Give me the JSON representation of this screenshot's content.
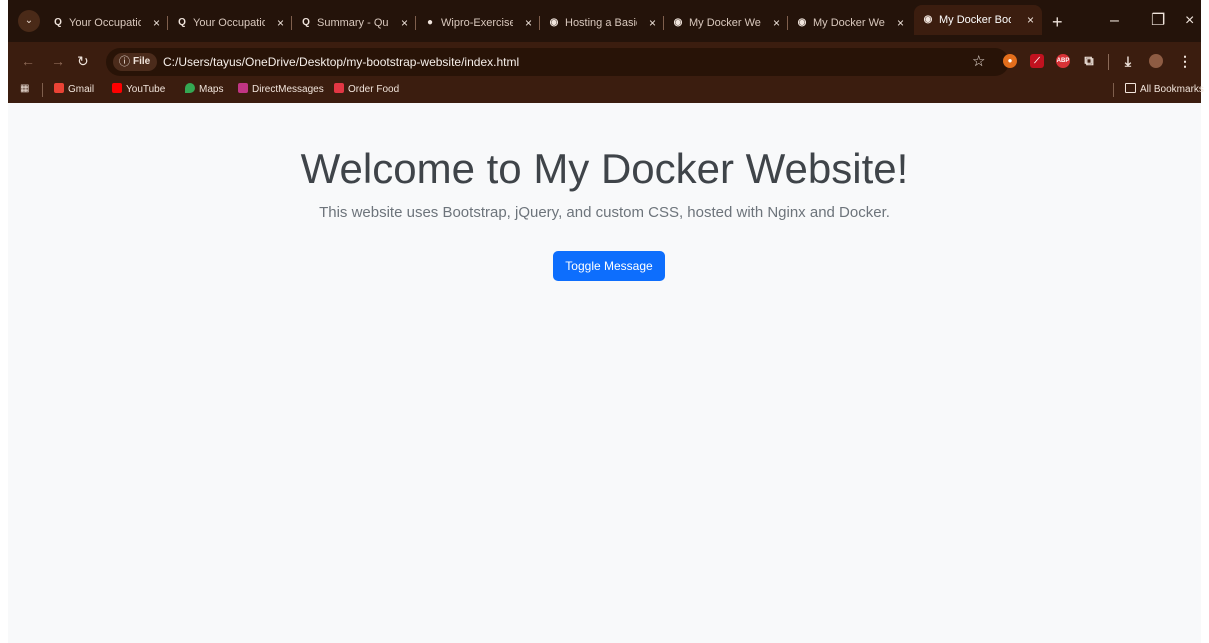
{
  "browser": {
    "tabs": [
      {
        "icon": "q-logo-icon",
        "title": "Your Occupation",
        "active": false
      },
      {
        "icon": "q-logo-icon",
        "title": "Your Occupation",
        "active": false
      },
      {
        "icon": "q-logo-icon",
        "title": "Summary - Quiz",
        "active": false
      },
      {
        "icon": "github-icon",
        "title": "Wipro-Exercises",
        "active": false
      },
      {
        "icon": "globe-icon",
        "title": "Hosting a Basic W",
        "active": false
      },
      {
        "icon": "globe-icon",
        "title": "My Docker Web",
        "active": false
      },
      {
        "icon": "globe-icon",
        "title": "My Docker Web",
        "active": false
      },
      {
        "icon": "globe-icon",
        "title": "My Docker Boot",
        "active": true
      }
    ],
    "tab_close": "×",
    "new_tab": "+",
    "window_controls": {
      "minimize": "–",
      "restore": "❐",
      "close": "×"
    },
    "address": {
      "scheme_label": "File",
      "url": "C:/Users/tayus/OneDrive/Desktop/my-bootstrap-website/index.html"
    },
    "bookmarks": [
      {
        "label": "Gmail",
        "icon": "gmail-icon",
        "color": "#ea4335"
      },
      {
        "label": "YouTube",
        "icon": "youtube-icon",
        "color": "#ff0000"
      },
      {
        "label": "Maps",
        "icon": "maps-icon",
        "color": "#34a853"
      },
      {
        "label": "DirectMessages",
        "icon": "instagram-icon",
        "color": "#c13584"
      },
      {
        "label": "Order Food",
        "icon": "order-food-icon",
        "color": "#e23744"
      }
    ],
    "all_bookmarks": "All Bookmarks",
    "extensions": {
      "abp_label": "ABP"
    }
  },
  "page": {
    "title": "Welcome to My Docker Website!",
    "subtitle": "This website uses Bootstrap, jQuery, and custom CSS, hosted with Nginx and Docker.",
    "button_label": "Toggle Message"
  }
}
